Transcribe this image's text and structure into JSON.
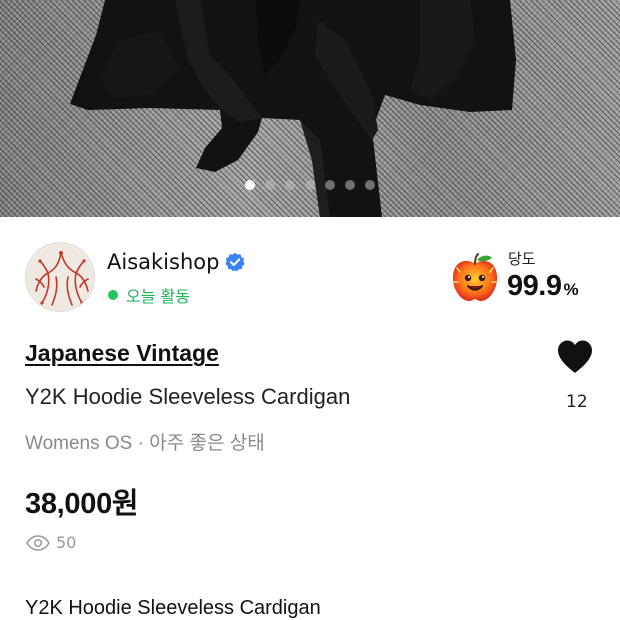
{
  "hero": {
    "image_icon": "black-cardigan-photo",
    "carousel_pages": 7,
    "carousel_active_index": 0
  },
  "seller": {
    "name": "Aisakishop",
    "verified_icon": "verified-check-icon",
    "activity": "오늘 활동",
    "activity_color": "#22c55e"
  },
  "sweetness": {
    "icon": "apple-mascot-icon",
    "label": "당도",
    "value": "99.9",
    "unit": "%"
  },
  "product": {
    "brand": "Japanese Vintage",
    "title": "Y2K Hoodie Sleeveless Cardigan",
    "meta": "Womens OS · 아주 좋은 상태",
    "price": "38,000원",
    "views": "50",
    "views_icon": "eye-icon"
  },
  "like": {
    "icon": "heart-icon",
    "count": "12"
  },
  "description": {
    "first_line": "Y2K Hoodie Sleeveless Cardigan"
  }
}
